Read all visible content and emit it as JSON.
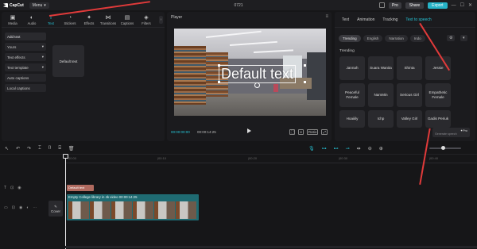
{
  "titlebar": {
    "app_name": "CapCut",
    "menu_label": "Menu",
    "project_name": "0721",
    "pro_label": "Pro",
    "share_label": "Share",
    "export_label": "Export",
    "minimize": "—",
    "maximize": "☐",
    "close": "✕"
  },
  "toolbar": {
    "items": [
      {
        "label": "Media",
        "glyph": "▣"
      },
      {
        "label": "Audio",
        "glyph": "◐"
      },
      {
        "label": "Text",
        "glyph": "T"
      },
      {
        "label": "Stickers",
        "glyph": "◔"
      },
      {
        "label": "Effects",
        "glyph": "✦"
      },
      {
        "label": "Transitions",
        "glyph": "⋈"
      },
      {
        "label": "Captions",
        "glyph": "▤"
      },
      {
        "label": "Filters",
        "glyph": "◈"
      }
    ],
    "more": "›"
  },
  "text_categories": [
    {
      "label": "Add text",
      "suffix": ""
    },
    {
      "label": "Yours",
      "suffix": "▾"
    },
    {
      "label": "Text effects",
      "suffix": "▾"
    },
    {
      "label": "Text template",
      "suffix": "▾"
    },
    {
      "label": "Auto captions",
      "suffix": ""
    },
    {
      "label": "Local captions",
      "suffix": ""
    }
  ],
  "preset": {
    "label": "Default text"
  },
  "player": {
    "label": "Player",
    "overlay_text": "Default text",
    "timecode_current": "00:00:00:00",
    "timecode_duration": "00:00:14:25",
    "icons": [
      "⛶",
      "⌖",
      "Ratio",
      "⤢"
    ]
  },
  "right_panel": {
    "tabs": [
      "Text",
      "Animation",
      "Tracking",
      "Text to speech"
    ],
    "active_tab": "Text to speech",
    "filters": [
      "Trending",
      "English",
      "Narration",
      "Indo"
    ],
    "section_title": "Trending",
    "voices": [
      "Jannah",
      "Suara Wanita",
      "Shinta",
      "Jessie",
      "Peaceful Female",
      "NamMin",
      "Serious Girl",
      "Empathetic Female",
      "Hoaiiily",
      "Ichp",
      "Valley Girl",
      "Gadis Periuk"
    ],
    "tooltip_pro": "✦Pro",
    "tooltip_text": "Generate speech"
  },
  "timeline": {
    "ruler_marks": [
      "00:00",
      "|00:10",
      "|00:20",
      "|00:30",
      "|00:40"
    ],
    "text_clip_label": "Default text",
    "video_clip_label": "Empty College library in 4k video   00:00:14:25",
    "cover_label": "Cover",
    "tool_icons_left": [
      "↖",
      "↶",
      "↷",
      "⌶",
      "⌷",
      "⌸",
      "🗑"
    ],
    "tool_icons_right": [
      "🎙",
      "⊶",
      "⊷",
      "⊸",
      "⇹",
      "⊖",
      "⊕"
    ]
  }
}
